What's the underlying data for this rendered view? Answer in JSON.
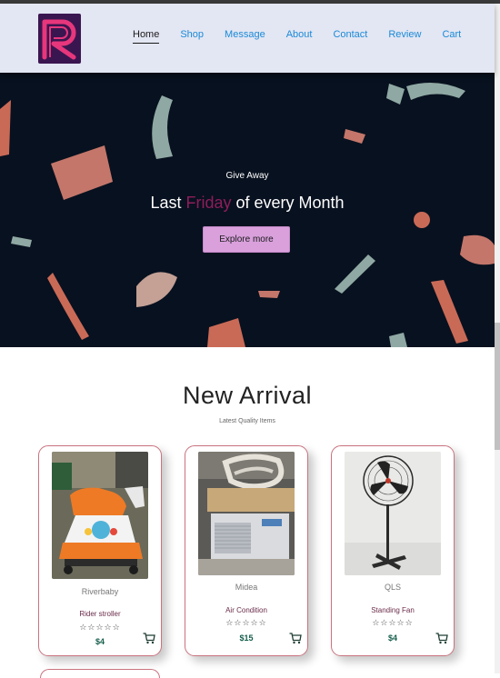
{
  "nav": {
    "items": [
      {
        "label": "Home",
        "active": true
      },
      {
        "label": "Shop"
      },
      {
        "label": "Message"
      },
      {
        "label": "About"
      },
      {
        "label": "Contact"
      },
      {
        "label": "Review"
      },
      {
        "label": "Cart"
      }
    ]
  },
  "hero": {
    "subtitle": "Give Away",
    "title_before": "Last ",
    "title_highlight": "Friday",
    "title_after": " of every Month",
    "button_label": "Explore more"
  },
  "arrivals": {
    "title": "New Arrival",
    "subtitle": "Latest Quality Items",
    "products": [
      {
        "brand": "Riverbaby",
        "name": "Rider stroller",
        "price": "$4",
        "stars": "☆☆☆☆☆"
      },
      {
        "brand": "Midea",
        "name": "Air Condition",
        "price": "$15",
        "stars": "☆☆☆☆☆"
      },
      {
        "brand": "QLS",
        "name": "Standing Fan",
        "price": "$4",
        "stars": "☆☆☆☆☆"
      }
    ]
  },
  "colors": {
    "nav_bg": "#e3e6f3",
    "link": "#1a8ad8",
    "hero_bg": "#08111f",
    "highlight": "#8e1d5b",
    "button_bg": "#d9a0dc",
    "card_border": "#c9737f",
    "price": "#155e4b"
  }
}
